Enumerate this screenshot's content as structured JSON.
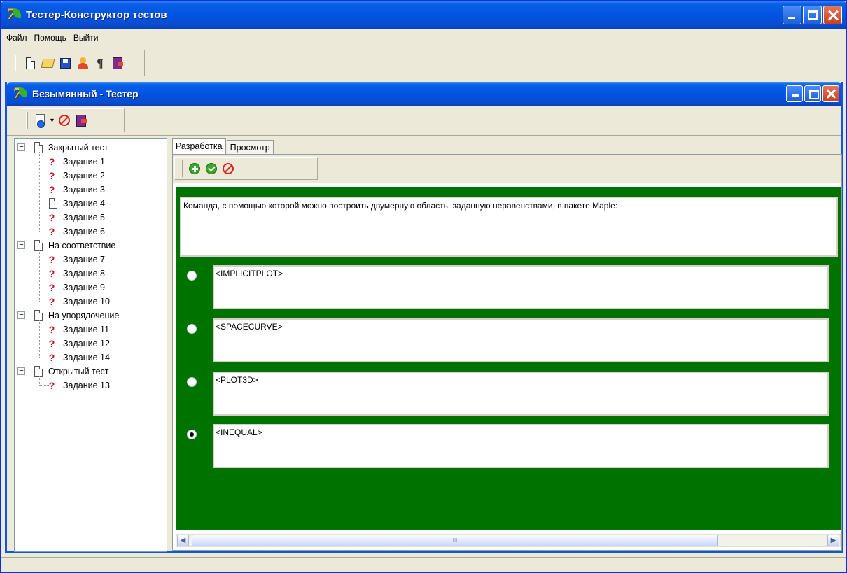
{
  "app": {
    "title": "Тестер-Конструктор тестов",
    "menu": [
      "Файл",
      "Помощь",
      "Выйти"
    ]
  },
  "toolbar_main": [
    "new-icon",
    "open-icon",
    "save-icon",
    "users-icon",
    "help-icon",
    "exit-icon"
  ],
  "child": {
    "title": "Безымянный - Тестер",
    "toolbar": [
      "add-dropdown-icon",
      "delete-icon",
      "exit-icon"
    ]
  },
  "tree": [
    {
      "label": "Закрытый тест",
      "children": [
        "Задание 1",
        "Задание 2",
        "Задание 3",
        "Задание 4",
        "Задание 5",
        "Задание 6"
      ]
    },
    {
      "label": "На соответствие",
      "children": [
        "Задание 7",
        "Задание 8",
        "Задание 9",
        "Задание 10"
      ]
    },
    {
      "label": "На упорядочение",
      "children": [
        "Задание 11",
        "Задание 12",
        "Задание 14"
      ]
    },
    {
      "label": "Открытый тест",
      "children": [
        "Задание 13"
      ]
    }
  ],
  "tabs": [
    "Разработка",
    "Просмотр"
  ],
  "panel_toolbar": [
    "add-icon",
    "check-icon",
    "delete-icon"
  ],
  "question": "Команда, с помощью которой можно построить двумерную область, заданную неравенствами, в пакете Maple:",
  "answers": [
    {
      "text": "<IMPLICITPLOT>",
      "checked": false
    },
    {
      "text": "<SPACECURVE>",
      "checked": false
    },
    {
      "text": "<PLOT3D>",
      "checked": false
    },
    {
      "text": "<INEQUAL>",
      "checked": true
    }
  ],
  "scroll_thumb_glyph": "III",
  "colors": {
    "editor_bg": "#007200",
    "titlebar": "#0054e3",
    "task_icon": "#c8101e"
  }
}
